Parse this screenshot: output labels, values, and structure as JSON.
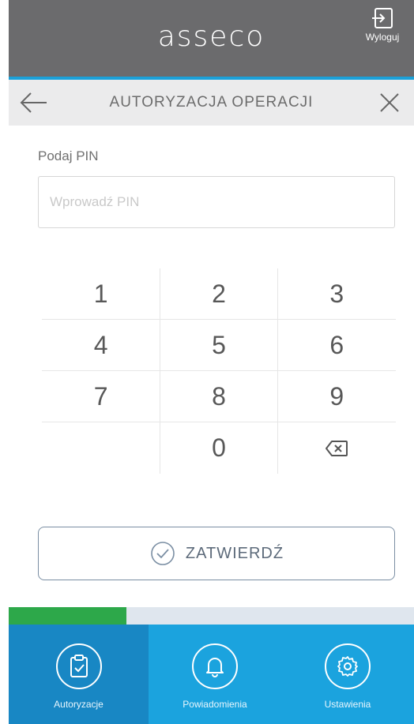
{
  "header": {
    "logo_text": "asseco",
    "logout_label": "Wyloguj",
    "logout_icon": "logout-icon",
    "background_color": "#6b6b6d",
    "accent_color": "#1ba0d8"
  },
  "titlebar": {
    "title": "AUTORYZACJA OPERACJI",
    "back_icon": "arrow-left-icon",
    "close_icon": "close-icon"
  },
  "pin": {
    "label": "Podaj PIN",
    "placeholder": "Wprowadź PIN",
    "value": ""
  },
  "keypad": {
    "keys": [
      "1",
      "2",
      "3",
      "4",
      "5",
      "6",
      "7",
      "8",
      "9",
      "",
      "0",
      "⌫"
    ],
    "backspace_icon": "backspace-icon"
  },
  "confirm": {
    "label": "ZATWIERDŹ",
    "icon": "check-circle-icon"
  },
  "progress": {
    "fraction": 0.29,
    "color": "#2da84a"
  },
  "bottom_nav": {
    "items": [
      {
        "label": "Autoryzacje",
        "icon": "clipboard-check-icon",
        "active": true
      },
      {
        "label": "Powiadomienia",
        "icon": "bell-icon",
        "active": false
      },
      {
        "label": "Ustawienia",
        "icon": "gear-icon",
        "active": false
      }
    ]
  }
}
